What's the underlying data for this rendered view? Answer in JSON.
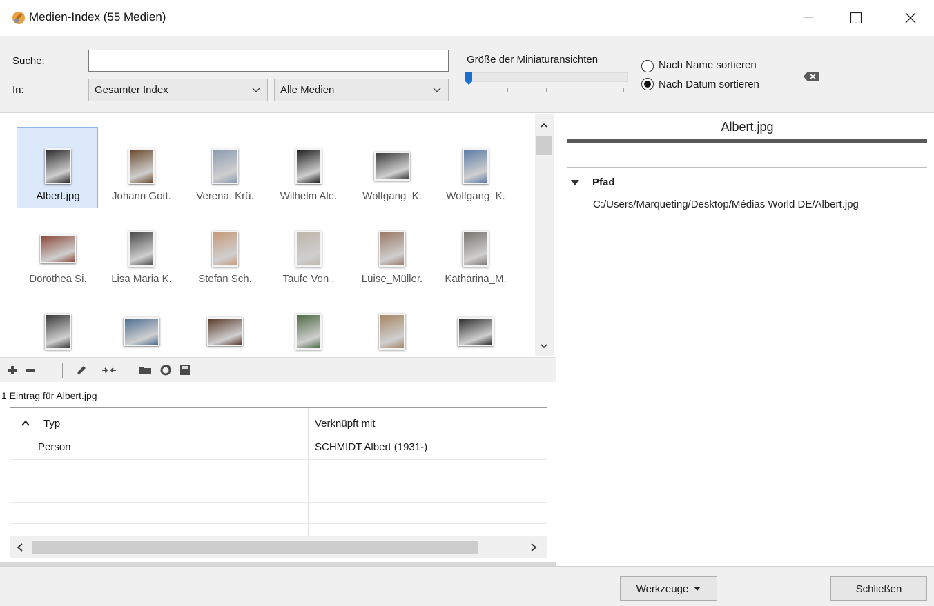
{
  "window": {
    "title": "Medien-Index (55 Medien)",
    "icons": [
      "app-icon",
      "minimize-icon",
      "maximize-icon",
      "close-icon"
    ]
  },
  "search": {
    "label": "Suche:",
    "value": "",
    "in_label": "In:",
    "scope_select": "Gesamter Index",
    "media_select": "Alle Medien",
    "thumb_size_label": "Größe der Miniaturansichten",
    "thumb_size_level": 0,
    "sort_by_name": "Nach Name sortieren",
    "sort_by_date": "Nach Datum sortieren",
    "sort_selected": "date"
  },
  "gallery": {
    "items": [
      {
        "label": "Albert.jpg",
        "selected": true,
        "tone": "#2a2a2a"
      },
      {
        "label": "Johann Gott.",
        "selected": false,
        "tone": "#6b4a2e"
      },
      {
        "label": "Verena_Krü.",
        "selected": false,
        "tone": "#8a9bb0"
      },
      {
        "label": "Wilhelm Ale.",
        "selected": false,
        "tone": "#1d1d1d"
      },
      {
        "label": "Wolfgang_K.",
        "selected": false,
        "tone": "#3a3a3a"
      },
      {
        "label": "Wolfgang_K.",
        "selected": false,
        "tone": "#5c7aa6"
      },
      {
        "label": "Dorothea Si.",
        "selected": false,
        "tone": "#8c4a3a"
      },
      {
        "label": "Lisa Maria K.",
        "selected": false,
        "tone": "#4a4a4a"
      },
      {
        "label": "Stefan Sch.",
        "selected": false,
        "tone": "#c79a7a"
      },
      {
        "label": "Taufe Von .",
        "selected": false,
        "tone": "#bdb6aa"
      },
      {
        "label": "Luise_Müller.",
        "selected": false,
        "tone": "#9a7a66"
      },
      {
        "label": "Katharina_M.",
        "selected": false,
        "tone": "#7a7570"
      },
      {
        "label": "",
        "selected": false,
        "tone": "#3a3a3a"
      },
      {
        "label": "",
        "selected": false,
        "tone": "#4e6e93"
      },
      {
        "label": "",
        "selected": false,
        "tone": "#5a3a2a"
      },
      {
        "label": "",
        "selected": false,
        "tone": "#4f6b45"
      },
      {
        "label": "",
        "selected": false,
        "tone": "#a88766"
      },
      {
        "label": "",
        "selected": false,
        "tone": "#2c2c2c"
      }
    ]
  },
  "toolbar": {
    "icons": [
      "add-icon",
      "remove-icon",
      "edit-icon",
      "merge-icon",
      "folder-icon",
      "refresh-icon",
      "save-icon"
    ]
  },
  "entries": {
    "count_text": "1 Eintrag für Albert.jpg",
    "col_type": "Typ",
    "col_linked": "Verknüpft mit",
    "rows": [
      {
        "type": "Person",
        "linked": "SCHMIDT Albert (1931-)"
      }
    ]
  },
  "details": {
    "title": "Albert.jpg",
    "path_label": "Pfad",
    "path_value": "C:/Users/Marqueting/Desktop/Médias World DE/Albert.jpg"
  },
  "footer": {
    "tools_button": "Werkzeuge",
    "close_button": "Schließen"
  }
}
